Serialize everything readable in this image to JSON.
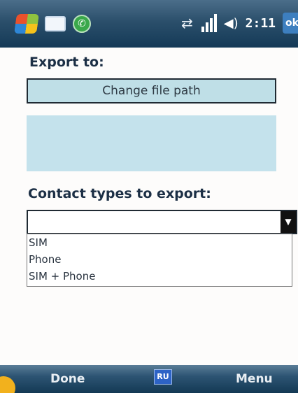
{
  "statusbar": {
    "clock": "2:11",
    "ok_label": "ok",
    "icons": [
      "windows-start-icon",
      "messaging-icon",
      "phone-call-icon",
      "sync-icon",
      "signal-strength-icon",
      "volume-icon"
    ]
  },
  "export": {
    "label": "Export to:",
    "change_path_label": "Change file path",
    "path_value": ""
  },
  "contact_types": {
    "label": "Contact types to export:",
    "selected": "",
    "options": [
      "SIM",
      "Phone",
      "SIM + Phone"
    ]
  },
  "softkeys": {
    "left": "Done",
    "center_indicator": "RU",
    "right": "Menu"
  }
}
